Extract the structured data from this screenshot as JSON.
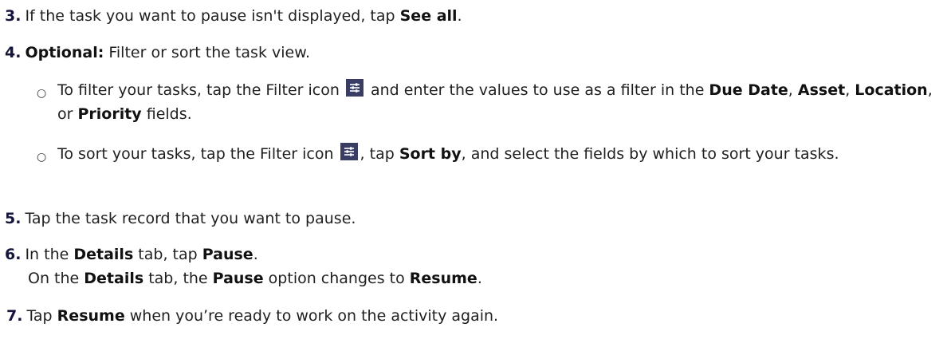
{
  "steps": {
    "s3": {
      "num": "3.",
      "t1": "If the task you want to pause isn't displayed, tap ",
      "b1": "See all",
      "t2": "."
    },
    "s4": {
      "num": "4.",
      "b1": "Optional:",
      "t1": " Filter or sort the task view.",
      "sub1": {
        "bullet": "○",
        "t1": "To filter your tasks, tap the Filter icon ",
        "t2": " and enter the values to use as a filter in the ",
        "b1": "Due Date",
        "t3": ", ",
        "b2": "Asset",
        "t4": ", ",
        "b3": "Location",
        "t5": ", or ",
        "b4": "Priority",
        "t6": " fields."
      },
      "sub2": {
        "bullet": "○",
        "t1": "To sort your tasks, tap the Filter icon ",
        "t2": ", tap ",
        "b1": "Sort by",
        "t3": ", and select the fields by which to sort your tasks."
      }
    },
    "s5": {
      "num": "5.",
      "t1": "Tap the task record that you want to pause."
    },
    "s6": {
      "num": "6.",
      "t1": "In the ",
      "b1": "Details",
      "t2": " tab, tap ",
      "b2": "Pause",
      "t3": ".",
      "line2": {
        "t1": "On the ",
        "b1": "Details",
        "t2": " tab, the ",
        "b2": "Pause",
        "t3": " option changes to ",
        "b3": "Resume",
        "t4": "."
      }
    },
    "s7": {
      "num": "7.",
      "t1": "Tap ",
      "b1": "Resume",
      "t2": " when you’re ready to work on the activity again."
    }
  },
  "icons": {
    "filter_icon": "filter-sliders-icon",
    "icon_color": "#3a3d63"
  }
}
